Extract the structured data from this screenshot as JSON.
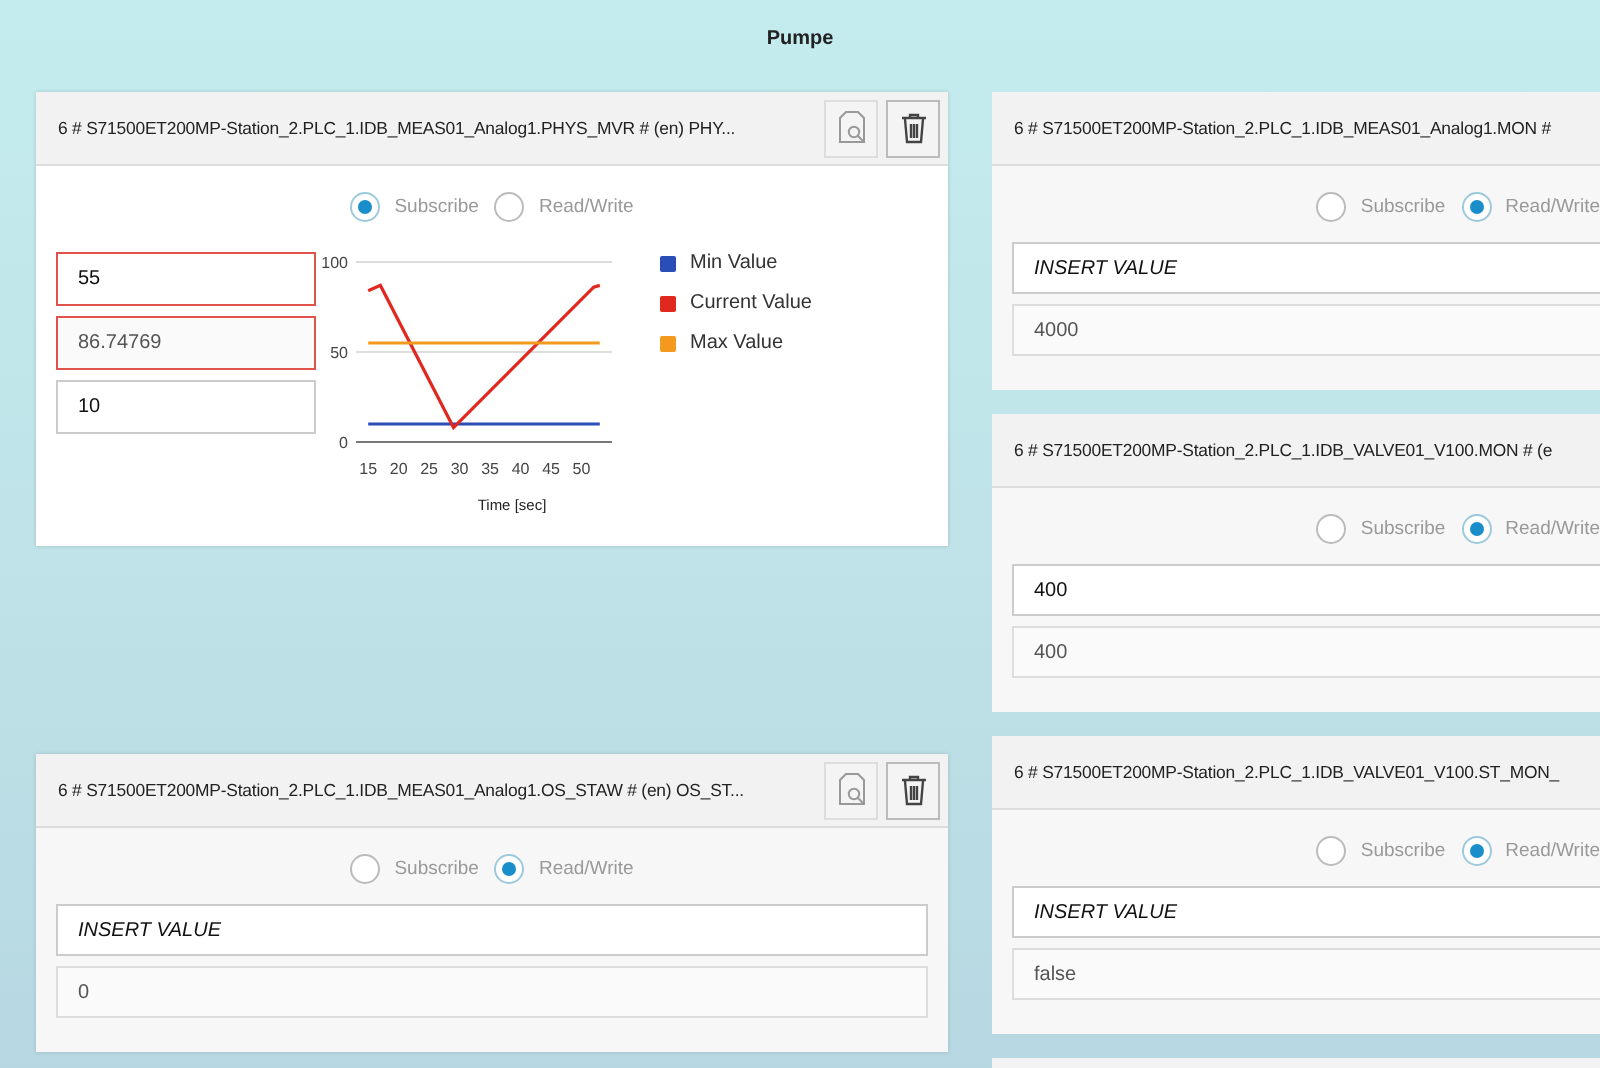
{
  "title": "Pumpe",
  "columns": [
    {
      "cards": [
        {
          "kind": "chart",
          "header": "6 # S71500ET200MP-Station_2.PLC_1.IDB_MEAS01_Analog1.PHYS_MVR # (en) PHY...",
          "actions_visible": true,
          "modes": [
            {
              "label": "Subscribe",
              "selected": true
            },
            {
              "label": "Read/Write",
              "selected": false
            }
          ],
          "fields": [
            {
              "kind": "input",
              "value": "55",
              "alert": true
            },
            {
              "kind": "reading",
              "value": "86.74769",
              "alert": true
            },
            {
              "kind": "input",
              "value": "10",
              "alert": false
            }
          ],
          "chart_data": {
            "type": "line",
            "xlabel": "Time [sec]",
            "xlim": [
              13,
              55
            ],
            "x": [
              15,
              17,
              29,
              52,
              53
            ],
            "xticks": [
              15,
              20,
              25,
              30,
              35,
              40,
              45,
              50
            ],
            "yticks": [
              0,
              50,
              100
            ],
            "ylim": [
              0,
              100
            ],
            "series": [
              {
                "name": "Min Value",
                "color": "#2a4db8",
                "values": [
                  10,
                  10,
                  10,
                  10,
                  10
                ]
              },
              {
                "name": "Current Value",
                "color": "#e0281e",
                "values": [
                  84,
                  87,
                  8,
                  86,
                  87
                ]
              },
              {
                "name": "Max Value",
                "color": "#f39a1e",
                "values": [
                  55,
                  55,
                  55,
                  55,
                  55
                ]
              }
            ]
          }
        },
        {
          "kind": "value",
          "header": "6 # S71500ET200MP-Station_2.PLC_1.IDB_MEAS01_Analog1.OS_STAW # (en) OS_ST...",
          "actions_visible": true,
          "modes": [
            {
              "label": "Subscribe",
              "selected": false
            },
            {
              "label": "Read/Write",
              "selected": true
            }
          ],
          "input": {
            "placeholder": "INSERT VALUE"
          },
          "reading": "0"
        }
      ]
    },
    {
      "cards": [
        {
          "kind": "value",
          "header": "6 # S71500ET200MP-Station_2.PLC_1.IDB_MEAS01_Analog1.MON #",
          "actions_visible": false,
          "modes": [
            {
              "label": "Subscribe",
              "selected": false
            },
            {
              "label": "Read/Write",
              "selected": true
            }
          ],
          "input": {
            "placeholder": "INSERT VALUE"
          },
          "reading": "4000"
        },
        {
          "kind": "value",
          "header": "6 # S71500ET200MP-Station_2.PLC_1.IDB_VALVE01_V100.MON # (e",
          "actions_visible": false,
          "modes": [
            {
              "label": "Subscribe",
              "selected": false
            },
            {
              "label": "Read/Write",
              "selected": true
            }
          ],
          "input": {
            "value": "400"
          },
          "reading": "400"
        },
        {
          "kind": "value",
          "header": "6 # S71500ET200MP-Station_2.PLC_1.IDB_VALVE01_V100.ST_MON_",
          "actions_visible": false,
          "modes": [
            {
              "label": "Subscribe",
              "selected": false
            },
            {
              "label": "Read/Write",
              "selected": true
            }
          ],
          "input": {
            "placeholder": "INSERT VALUE"
          },
          "reading": "false"
        }
      ]
    }
  ]
}
